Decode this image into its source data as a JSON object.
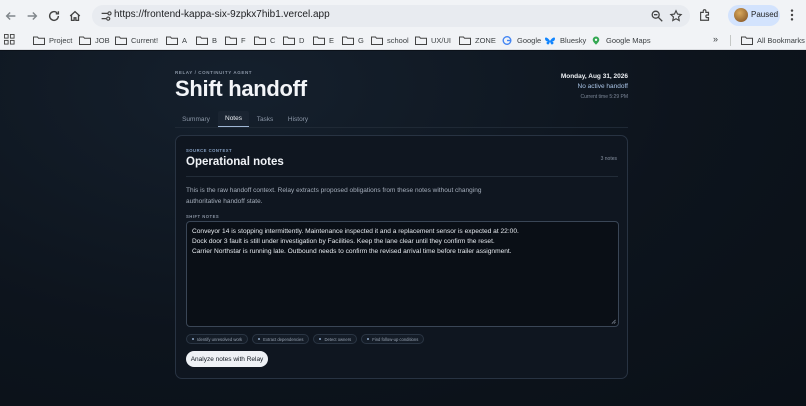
{
  "browser": {
    "url": "https://frontend-kappa-six-9zpkx7hib1.vercel.app",
    "profile_label": "Paused",
    "bookmarks": [
      {
        "label": "Project",
        "icon": "folder-icon"
      },
      {
        "label": "JOB",
        "icon": "folder-icon"
      },
      {
        "label": "Current!",
        "icon": "folder-icon"
      },
      {
        "label": "A",
        "icon": "folder-icon"
      },
      {
        "label": "B",
        "icon": "folder-icon"
      },
      {
        "label": "F",
        "icon": "folder-icon"
      },
      {
        "label": "C",
        "icon": "folder-icon"
      },
      {
        "label": "D",
        "icon": "folder-icon"
      },
      {
        "label": "E",
        "icon": "folder-icon"
      },
      {
        "label": "G",
        "icon": "folder-icon"
      },
      {
        "label": "school",
        "icon": "folder-icon"
      },
      {
        "label": "UX/UI",
        "icon": "folder-icon"
      },
      {
        "label": "ZONE",
        "icon": "folder-icon"
      },
      {
        "label": "Google",
        "icon": "google-icon"
      },
      {
        "label": "Bluesky",
        "icon": "bluesky-icon"
      },
      {
        "label": "Google Maps",
        "icon": "maps-icon"
      }
    ],
    "more_label": "»",
    "all_bookmarks_label": "All Bookmarks"
  },
  "header": {
    "eyebrow": "RELAY / CONTINUITY AGENT",
    "title": "Shift handoff",
    "date": "Monday, Aug 31, 2026",
    "handoff_status": "No active handoff",
    "current_time": "Current time 5:29 PM"
  },
  "tabs": [
    {
      "label": "Summary",
      "active": false
    },
    {
      "label": "Notes",
      "active": true
    },
    {
      "label": "Tasks",
      "active": false
    },
    {
      "label": "History",
      "active": false
    }
  ],
  "card": {
    "eyebrow": "SOURCE CONTEXT",
    "title": "Operational notes",
    "note_count": "3 notes",
    "description": "This is the raw handoff context. Relay extracts proposed obligations from these notes without changing authoritative handoff state.",
    "field_label": "SHIFT NOTES",
    "notes": [
      "Conveyor 14 is stopping intermittently. Maintenance inspected it and a replacement sensor is expected at 22:00.",
      "Dock door 3 fault is still under investigation by Facilities. Keep the lane clear until they confirm the reset.",
      "Carrier Northstar is running late. Outbound needs to confirm the revised arrival time before trailer assignment."
    ],
    "chips": [
      "Identify unresolved work",
      "Extract dependencies",
      "Detect owners",
      "Find follow-up conditions"
    ],
    "action_label": "Analyze notes with Relay"
  },
  "colors": {
    "page_bg": "#0b1119",
    "card_bg": "#0f1620",
    "accent": "#9fb6d4",
    "button_bg": "#eef1f5"
  }
}
